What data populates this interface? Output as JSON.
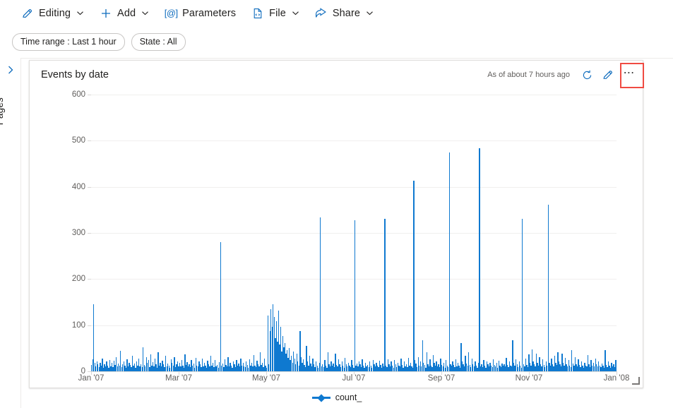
{
  "toolbar": {
    "items": [
      {
        "label": "Editing",
        "icon": "pencil-icon",
        "caret": true
      },
      {
        "label": "Add",
        "icon": "plus-icon",
        "caret": true
      },
      {
        "label": "Parameters",
        "icon": "parameters-icon",
        "caret": false
      },
      {
        "label": "File",
        "icon": "file-icon",
        "caret": true
      },
      {
        "label": "Share",
        "icon": "share-icon",
        "caret": true
      }
    ]
  },
  "filters": {
    "chips": [
      {
        "label": "Time range : Last 1 hour"
      },
      {
        "label": "State : All"
      }
    ]
  },
  "rail": {
    "label": "Pages",
    "expand_icon": "chevron-right-icon"
  },
  "card": {
    "title": "Events by date",
    "as_of": "As of about 7 hours ago",
    "refresh_icon": "refresh-icon",
    "edit_icon": "pencil-icon",
    "more_icon": "ellipsis-icon",
    "resize_icon": "resize-handle-icon",
    "highlight_color": "#f04b42"
  },
  "colors": {
    "accent": "#0f6cbd",
    "series": "#0f79d0",
    "grid": "#f0efee",
    "axis": "#d9d7d5"
  },
  "chart_data": {
    "type": "bar",
    "title": "Events by date",
    "xlabel": "",
    "ylabel": "",
    "ylim": [
      0,
      600
    ],
    "yticks": [
      0,
      100,
      200,
      300,
      400,
      500,
      600
    ],
    "grid": true,
    "legend": {
      "position": "bottom",
      "entries": [
        "count_"
      ]
    },
    "series": [
      {
        "name": "count_",
        "color": "#0f79d0"
      }
    ],
    "xticks": [
      {
        "label": "Jan '07",
        "pos": 0.0
      },
      {
        "label": "Mar '07",
        "pos": 0.1667
      },
      {
        "label": "May '07",
        "pos": 0.3333
      },
      {
        "label": "Jul '07",
        "pos": 0.5
      },
      {
        "label": "Sep '07",
        "pos": 0.6667
      },
      {
        "label": "Nov '07",
        "pos": 0.8333
      },
      {
        "label": "Jan '08",
        "pos": 1.0
      }
    ],
    "x_start": "2007-01-01",
    "x_end": "2008-01-01",
    "x_unit": "day",
    "notable_spikes": [
      {
        "x": "Jan '07",
        "value": 145
      },
      {
        "x": "Mar '07",
        "value": 280
      },
      {
        "x": "Apr '07",
        "value": 122
      },
      {
        "x": "Apr '07",
        "value": 145
      },
      {
        "x": "May '07",
        "value": 334
      },
      {
        "x": "Jun '07",
        "value": 328
      },
      {
        "x": "Jul '07",
        "value": 331
      },
      {
        "x": "Aug '07",
        "value": 414
      },
      {
        "x": "Sep '07",
        "value": 475
      },
      {
        "x": "Oct '07",
        "value": 483
      },
      {
        "x": "Nov '07",
        "value": 330
      },
      {
        "x": "Dec '07",
        "value": 361
      }
    ],
    "values": [
      14,
      26,
      145,
      18,
      11,
      22,
      16,
      9,
      19,
      12,
      27,
      8,
      15,
      10,
      21,
      13,
      7,
      24,
      11,
      18,
      9,
      23,
      14,
      31,
      10,
      17,
      12,
      44,
      9,
      15,
      22,
      13,
      8,
      26,
      11,
      19,
      14,
      9,
      33,
      12,
      17,
      8,
      21,
      13,
      27,
      10,
      16,
      9,
      52,
      14,
      11,
      31,
      18,
      24,
      9,
      36,
      13,
      20,
      11,
      28,
      15,
      8,
      41,
      12,
      19,
      10,
      23,
      16,
      9,
      34,
      11,
      17,
      13,
      8,
      26,
      19,
      12,
      30,
      9,
      15,
      22,
      11,
      18,
      10,
      25,
      13,
      8,
      36,
      14,
      20,
      11,
      16,
      9,
      24,
      12,
      17,
      8,
      29,
      13,
      10,
      21,
      15,
      9,
      27,
      11,
      18,
      12,
      8,
      23,
      16,
      10,
      33,
      13,
      19,
      9,
      25,
      11,
      14,
      8,
      20,
      280,
      12,
      17,
      9,
      26,
      14,
      11,
      31,
      10,
      18,
      13,
      8,
      22,
      15,
      9,
      24,
      12,
      17,
      10,
      28,
      13,
      19,
      11,
      9,
      21,
      14,
      8,
      26,
      12,
      18,
      10,
      35,
      13,
      9,
      23,
      16,
      11,
      42,
      14,
      19,
      9,
      27,
      12,
      8,
      121,
      16,
      88,
      134,
      96,
      145,
      118,
      72,
      109,
      64,
      131,
      58,
      96,
      43,
      77,
      52,
      61,
      38,
      46,
      29,
      51,
      24,
      34,
      19,
      43,
      27,
      16,
      38,
      22,
      12,
      88,
      31,
      18,
      26,
      14,
      9,
      55,
      21,
      13,
      34,
      17,
      10,
      28,
      15,
      9,
      22,
      12,
      8,
      19,
      334,
      11,
      16,
      9,
      24,
      13,
      8,
      41,
      15,
      10,
      22,
      12,
      17,
      9,
      38,
      14,
      11,
      26,
      16,
      9,
      21,
      13,
      8,
      29,
      15,
      11,
      19,
      12,
      9,
      24,
      14,
      8,
      328,
      13,
      17,
      10,
      22,
      15,
      9,
      26,
      12,
      8,
      18,
      11,
      14,
      9,
      21,
      13,
      8,
      25,
      16,
      10,
      19,
      12,
      9,
      23,
      14,
      8,
      17,
      11,
      331,
      13,
      9,
      26,
      15,
      10,
      21,
      12,
      8,
      24,
      16,
      9,
      18,
      13,
      11,
      27,
      14,
      8,
      22,
      10,
      16,
      9,
      29,
      12,
      18,
      11,
      8,
      414,
      24,
      17,
      9,
      31,
      13,
      22,
      10,
      68,
      19,
      14,
      8,
      41,
      16,
      11,
      26,
      13,
      9,
      35,
      18,
      12,
      22,
      10,
      16,
      9,
      28,
      14,
      11,
      19,
      8,
      24,
      13,
      9,
      475,
      16,
      12,
      21,
      14,
      9,
      26,
      11,
      18,
      13,
      8,
      62,
      22,
      15,
      10,
      33,
      17,
      12,
      41,
      14,
      9,
      28,
      16,
      11,
      22,
      13,
      8,
      19,
      483,
      11,
      16,
      9,
      24,
      13,
      8,
      21,
      15,
      10,
      18,
      12,
      9,
      26,
      14,
      11,
      19,
      8,
      23,
      13,
      9,
      17,
      12,
      16,
      10,
      29,
      14,
      9,
      22,
      13,
      11,
      67,
      18,
      12,
      26,
      15,
      9,
      21,
      13,
      8,
      330,
      16,
      11,
      28,
      14,
      9,
      36,
      19,
      13,
      47,
      22,
      16,
      11,
      39,
      18,
      13,
      31,
      15,
      10,
      26,
      14,
      9,
      22,
      12,
      361,
      18,
      13,
      28,
      16,
      11,
      34,
      19,
      14,
      42,
      21,
      16,
      11,
      38,
      18,
      13,
      29,
      15,
      10,
      24,
      13,
      9,
      46,
      17,
      12,
      31,
      16,
      11,
      26,
      14,
      9,
      22,
      12,
      8,
      19,
      13,
      11,
      35,
      16,
      9,
      24,
      13,
      18,
      11,
      28,
      15,
      10,
      21,
      13,
      9,
      17,
      12,
      8,
      46,
      14,
      9,
      21,
      13,
      8,
      19,
      11,
      16,
      9,
      24
    ]
  }
}
